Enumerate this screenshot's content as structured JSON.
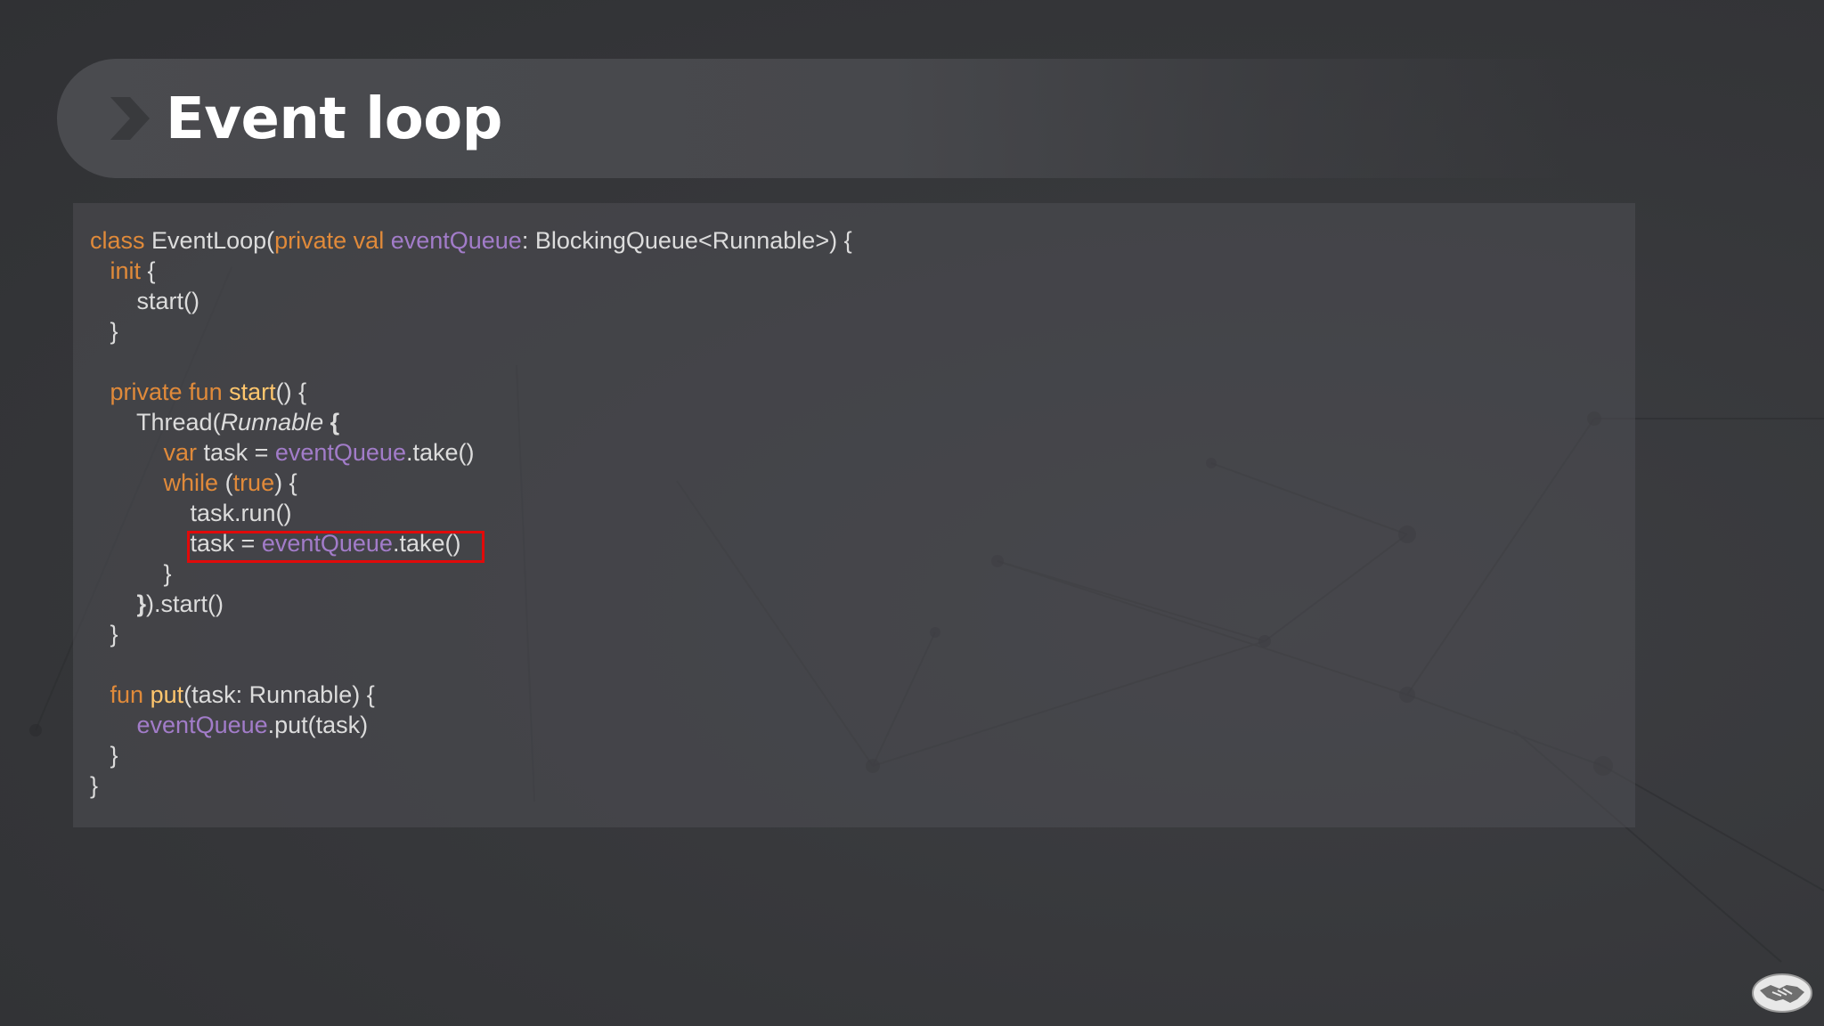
{
  "slide": {
    "title": "Event loop"
  },
  "icons": {
    "title_chevron": "chevron-right-icon",
    "logo": "handshake-icon"
  },
  "colors": {
    "background": "#3a3b3e",
    "title_text": "#ffffff",
    "keyword": "#e08a3a",
    "function_name": "#ffc66d",
    "property": "#a27cc9",
    "plain_text": "#dcdcdc",
    "highlight_border": "#e10a0a"
  },
  "code": {
    "lines": [
      [
        {
          "t": "class ",
          "c": "kw"
        },
        {
          "t": "EventLoop("
        },
        {
          "t": "private val ",
          "c": "kw"
        },
        {
          "t": "eventQueue",
          "c": "prop"
        },
        {
          "t": ": BlockingQueue<Runnable>) {"
        }
      ],
      [
        {
          "t": "   "
        },
        {
          "t": "init",
          "c": "kw"
        },
        {
          "t": " {"
        }
      ],
      [
        {
          "t": "       start()"
        }
      ],
      [
        {
          "t": "   }"
        }
      ],
      [],
      [
        {
          "t": "   "
        },
        {
          "t": "private fun ",
          "c": "kw"
        },
        {
          "t": "start",
          "c": "fn"
        },
        {
          "t": "() {"
        }
      ],
      [
        {
          "t": "       Thread("
        },
        {
          "t": "Runnable",
          "c": "it"
        },
        {
          "t": " {",
          "c": "bold"
        }
      ],
      [
        {
          "t": "           "
        },
        {
          "t": "var ",
          "c": "kw"
        },
        {
          "t": "task = "
        },
        {
          "t": "eventQueue",
          "c": "prop"
        },
        {
          "t": ".take()"
        }
      ],
      [
        {
          "t": "           "
        },
        {
          "t": "while ",
          "c": "kw"
        },
        {
          "t": "("
        },
        {
          "t": "true",
          "c": "kw"
        },
        {
          "t": ") {"
        }
      ],
      [
        {
          "t": "               task.run()"
        }
      ],
      [
        {
          "t": "               task = "
        },
        {
          "t": "eventQueue",
          "c": "prop"
        },
        {
          "t": ".take()"
        }
      ],
      [
        {
          "t": "           }"
        }
      ],
      [
        {
          "t": "       "
        },
        {
          "t": "}",
          "c": "bold"
        },
        {
          "t": ").start()"
        }
      ],
      [
        {
          "t": "   }"
        }
      ],
      [],
      [
        {
          "t": "   "
        },
        {
          "t": "fun ",
          "c": "kw"
        },
        {
          "t": "put",
          "c": "fn"
        },
        {
          "t": "(task: Runnable) {"
        }
      ],
      [
        {
          "t": "       "
        },
        {
          "t": "eventQueue",
          "c": "prop"
        },
        {
          "t": ".put(task)"
        }
      ],
      [
        {
          "t": "   }"
        }
      ],
      [
        {
          "t": "}"
        }
      ]
    ],
    "highlighted_line_index": 10
  }
}
